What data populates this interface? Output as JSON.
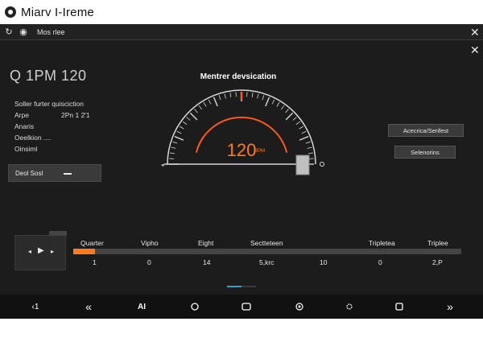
{
  "app": {
    "title": "Miarv I-Ireme"
  },
  "tabbar": {
    "label": "Mos rlee"
  },
  "readout": "Q 1PM 120",
  "info": {
    "heading": "Soller furter quisciction",
    "rows": [
      {
        "label": "Arpe",
        "value": "2Pn 1 2'1"
      },
      {
        "label": "Anaris",
        "value": ""
      },
      {
        "label": "Oeelkion ....",
        "value": ""
      },
      {
        "label": "Oinsiml",
        "value": ""
      }
    ]
  },
  "left_panel": {
    "label": "Deol Sosl"
  },
  "gauge": {
    "title": "Mentrer devsication",
    "value_text": "120",
    "unit": "BPM",
    "level": 0.5,
    "accent": "#ff5a1a"
  },
  "side_buttons": [
    "Acecrica/Serifest",
    "Selenorins"
  ],
  "tracks": {
    "headers": [
      "Quarter",
      "Vipho",
      "Eight",
      "Sectteteen",
      "Tripletea",
      "Triplee"
    ],
    "values": [
      "1",
      "0",
      "14",
      "5,krc",
      "10",
      "0",
      "2,P"
    ],
    "progress": 0.055,
    "accent": "#ff7a1a"
  },
  "navbar": {
    "items": [
      {
        "icon": "back-icon",
        "glyph": "‹1"
      },
      {
        "icon": "rewind-icon",
        "glyph": "«"
      },
      {
        "icon": "ai-icon",
        "glyph": "AI"
      },
      {
        "icon": "circle-icon",
        "glyph": ""
      },
      {
        "icon": "square-icon",
        "glyph": ""
      },
      {
        "icon": "target-icon",
        "glyph": ""
      },
      {
        "icon": "settings-icon",
        "glyph": ""
      },
      {
        "icon": "stop-icon",
        "glyph": ""
      },
      {
        "icon": "forward-icon",
        "glyph": "»"
      }
    ]
  },
  "colors": {
    "background": "#1c1c1c",
    "accent": "#ff7a1a",
    "indicator": "#29a3c6"
  }
}
